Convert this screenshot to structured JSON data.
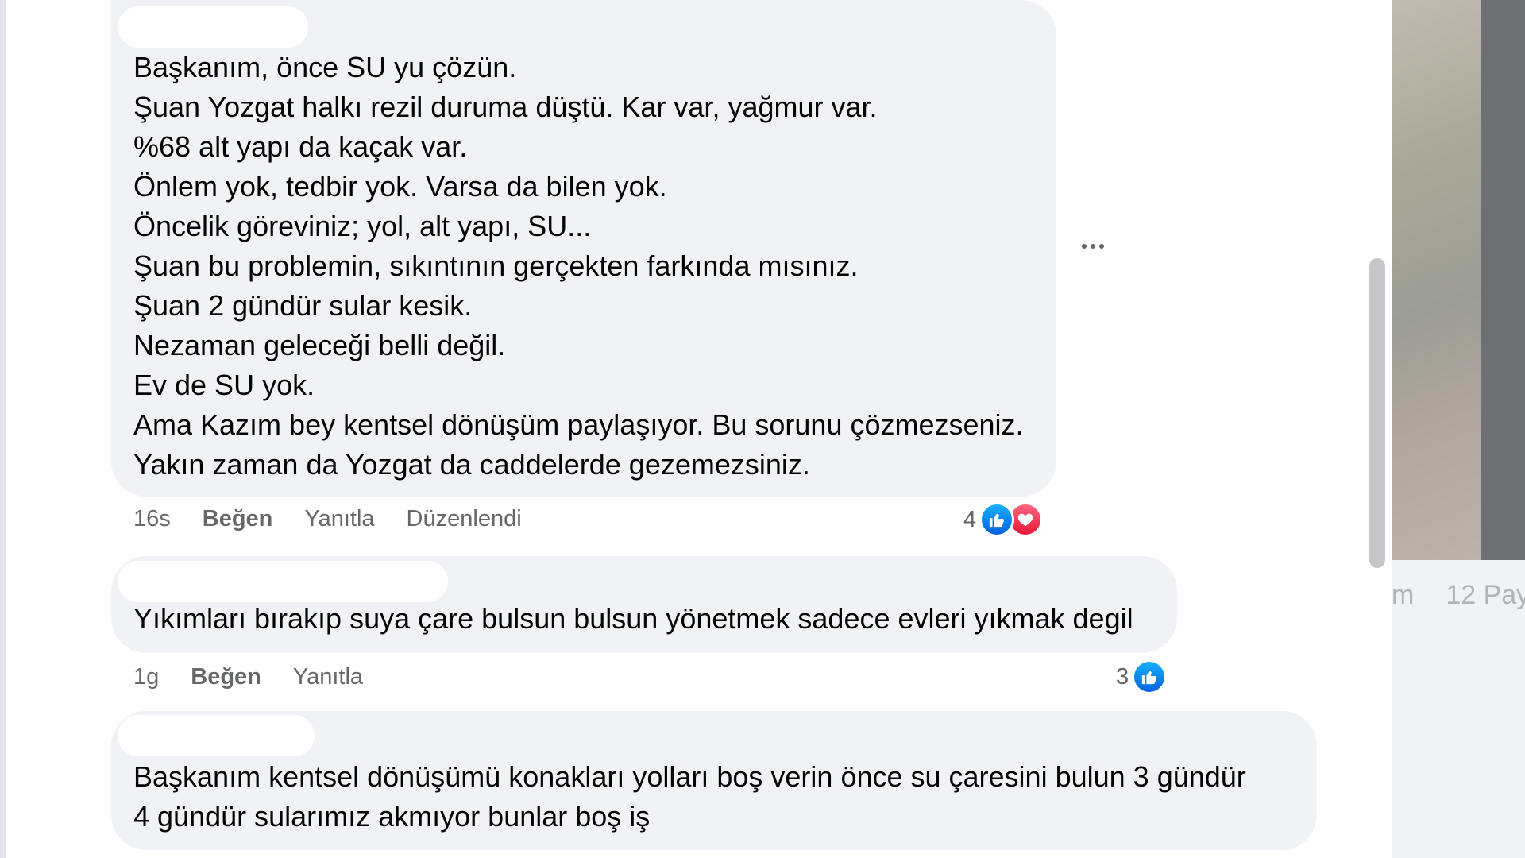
{
  "comments": [
    {
      "lines": [
        "Başkanım, önce SU yu çözün.",
        "Şuan Yozgat halkı rezil duruma düştü. Kar var, yağmur var.",
        "%68 alt yapı da kaçak var.",
        "Önlem yok, tedbir yok. Varsa da bilen yok.",
        "Öncelik göreviniz; yol, alt yapı, SU...",
        "Şuan bu problemin, sıkıntının gerçekten farkında mısınız.",
        "Şuan 2 gündür sular kesik.",
        "Nezaman geleceği belli değil.",
        "Ev de SU yok.",
        "Ama Kazım bey kentsel dönüşüm paylaşıyor. Bu sorunu çözmezseniz.",
        "Yakın zaman da Yozgat da caddelerde gezemezsiniz."
      ],
      "time": "16s",
      "like_label": "Beğen",
      "reply_label": "Yanıtla",
      "edited_label": "Düzenlendi",
      "reaction_count": "4",
      "reactions": [
        "like-icon",
        "love-icon"
      ]
    },
    {
      "lines": [
        "Yıkımları bırakıp suya çare bulsun bulsun yönetmek sadece evleri yıkmak degil"
      ],
      "time": "1g",
      "like_label": "Beğen",
      "reply_label": "Yanıtla",
      "reaction_count": "3",
      "reactions": [
        "like-icon"
      ]
    },
    {
      "lines": [
        "Başkanım kentsel dönüşümü konakları yolları boş verin önce su çaresini bulun 3 gündür",
        "4 gündür sularımız akmıyor bunlar boş iş"
      ]
    }
  ],
  "right_pane": {
    "meta_left": "m",
    "meta_shares": "12 Pay"
  },
  "colors": {
    "bubble": "#f0f2f5",
    "like_blue": "#0866ff",
    "love_red": "#e61739",
    "meta_text": "#65676b"
  }
}
